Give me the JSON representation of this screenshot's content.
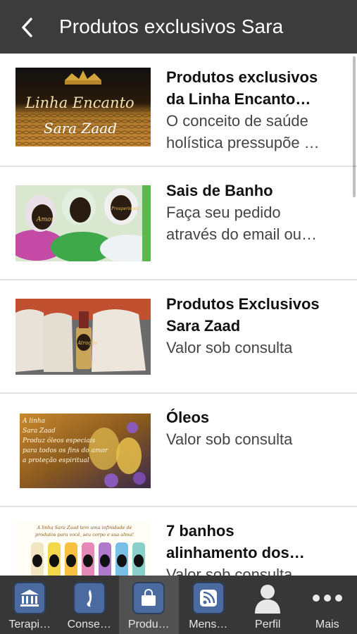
{
  "header": {
    "title": "Produtos exclusivos Sara",
    "back_icon": "chevron-left-icon"
  },
  "items": [
    {
      "title_line1": "Produtos exclusivos",
      "title_line2": "da Linha Encanto…",
      "desc_line1": "O conceito de saúde",
      "desc_line2": "holística pressupõe …",
      "image_text_1": "Linha Encanto",
      "image_text_2": "Sara Zaad"
    },
    {
      "title_line1": "Sais de Banho",
      "desc_line1": "Faça seu pedido",
      "desc_line2": "através do email ou…",
      "image_label_1": "Amor",
      "image_label_2": "Prosperidade"
    },
    {
      "title_line1": "Produtos Exclusivos",
      "title_line2": "Sara Zaad",
      "desc_line1": "Valor sob consulta",
      "image_label_1": "Atração"
    },
    {
      "title_line1": "Óleos",
      "desc_line1": "Valor sob consulta",
      "image_lines": [
        "A linha",
        "Sara Zaad",
        "Produz óleos especiais",
        "para todos os fins do amor",
        "a proteção espiritual"
      ]
    },
    {
      "title_line1": "7 banhos",
      "title_line2": "alinhamento dos…",
      "desc_line1": "Valor sob consulta",
      "image_lines": [
        "A linha Sara Zaad tem uma infinidade de",
        "produtos para você, seu corpo e sua alma!"
      ]
    }
  ],
  "tabs": [
    {
      "label": "Terapi…",
      "icon": "temple-icon",
      "active": false
    },
    {
      "label": "Conse…",
      "icon": "flame-icon",
      "active": false
    },
    {
      "label": "Produ…",
      "icon": "shopping-bag-icon",
      "active": true
    },
    {
      "label": "Mens…",
      "icon": "rss-icon",
      "active": false
    },
    {
      "label": "Perfil",
      "icon": "person-icon",
      "active": false
    },
    {
      "label": "Mais",
      "icon": "more-dots-icon",
      "active": false
    }
  ],
  "colors": {
    "header_bg": "#3c3c3c",
    "tabbar_bg": "#373737",
    "tab_active_bg": "#515151",
    "tab_icon_box": "#4a6aa0"
  }
}
